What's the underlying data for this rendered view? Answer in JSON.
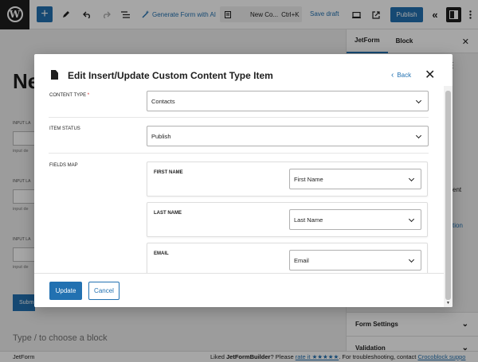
{
  "toolbar": {
    "ai_label": "Generate Form with AI",
    "doc_title": "New Co...",
    "shortcut": "Ctrl+K",
    "save_draft": "Save draft",
    "publish": "Publish"
  },
  "canvas": {
    "title_partial": "Ne",
    "field_label_partial": "INPUT LA",
    "field_desc_partial": "input de",
    "submit_partial": "Subm",
    "type_block": "Type / to choose a block"
  },
  "sidebar": {
    "tabs": [
      "JetForm",
      "Block"
    ],
    "rows": [
      {
        "label": "Form Settings"
      },
      {
        "label": "Validation"
      }
    ],
    "partial_text_1": "ent",
    "partial_text_2": "tion"
  },
  "statusbar": {
    "left": "JetForm",
    "liked_prefix": "Liked ",
    "liked_brand": "JetFormBuilder",
    "liked_mid": "? Please ",
    "rate_link": "rate it ★★★★★",
    "liked_suffix": ". For troubleshooting, contact ",
    "support_link": "Crocoblock suppo"
  },
  "modal": {
    "title": "Edit Insert/Update Custom Content Type Item",
    "back_label": "Back",
    "content_type": {
      "label": "CONTENT TYPE",
      "required_mark": "*",
      "value": "Contacts"
    },
    "item_status": {
      "label": "ITEM STATUS",
      "value": "Publish"
    },
    "fields_map": {
      "label": "FIELDS MAP",
      "items": [
        {
          "field": "FIRST NAME",
          "value": "First Name"
        },
        {
          "field": "LAST NAME",
          "value": "Last Name"
        },
        {
          "field": "EMAIL",
          "value": "Email"
        }
      ]
    },
    "update_label": "Update",
    "cancel_label": "Cancel"
  },
  "colors": {
    "accent": "#2271b1",
    "required": "#cc1818"
  }
}
